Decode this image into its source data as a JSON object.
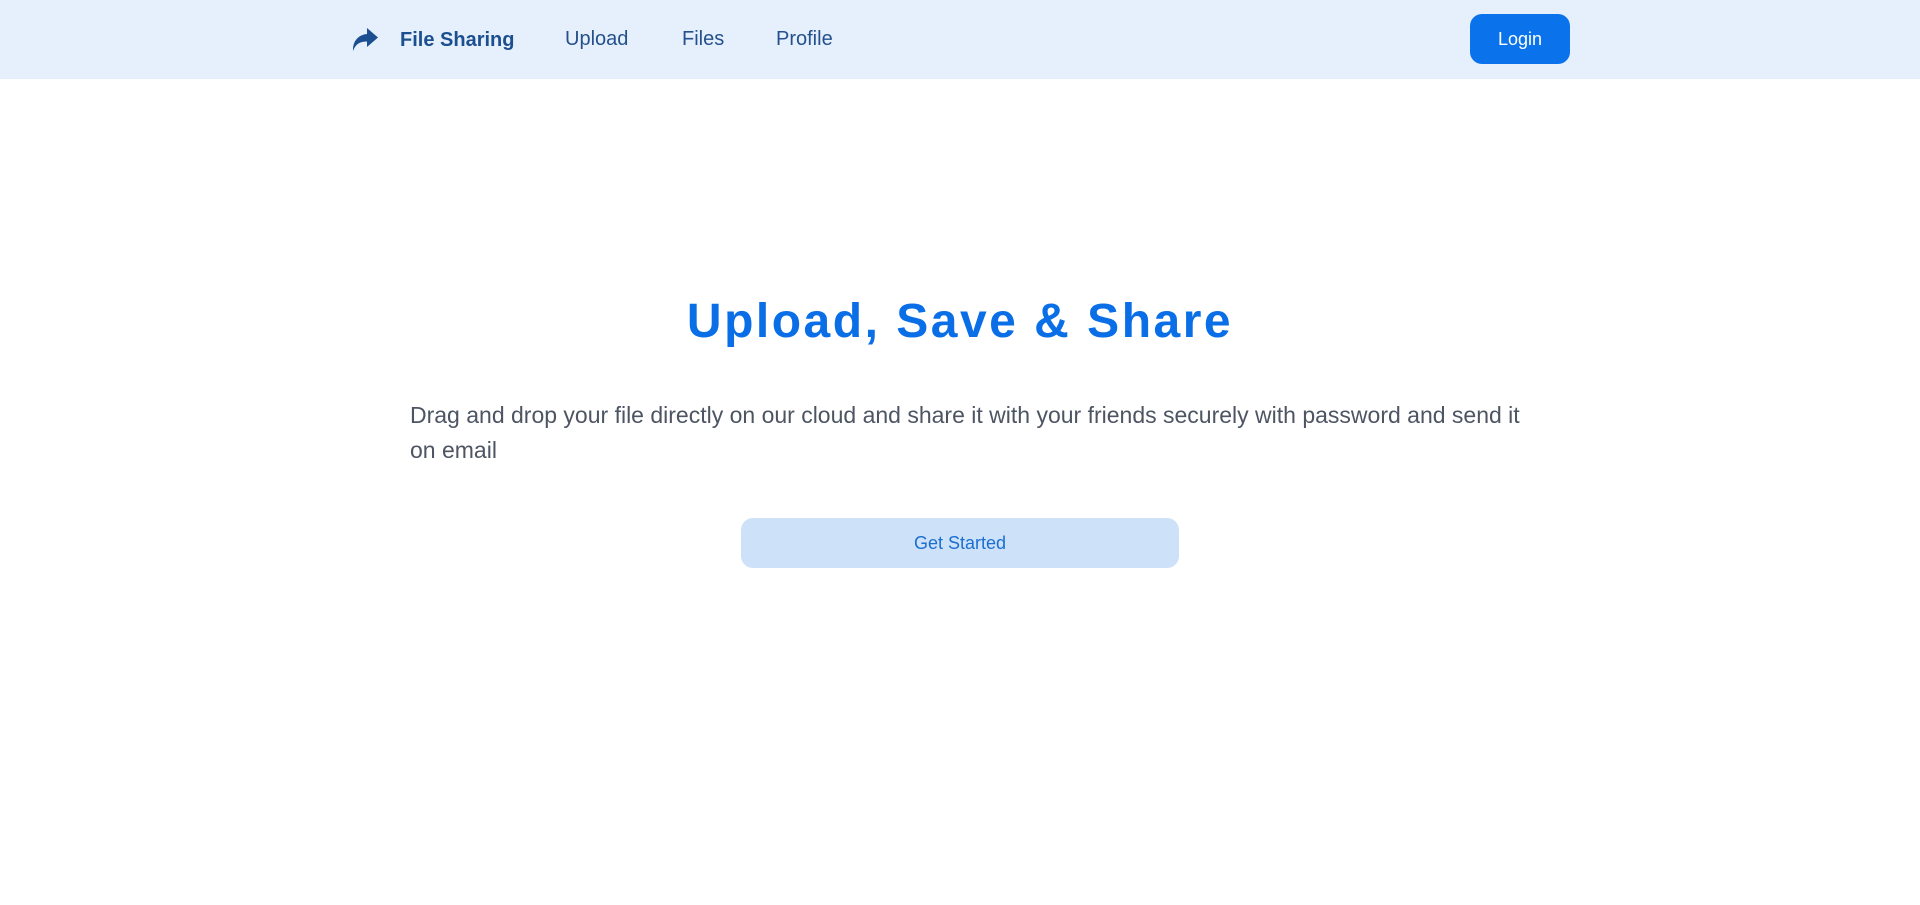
{
  "header": {
    "brand": {
      "icon": "share-arrow-icon",
      "title": "File Sharing"
    },
    "nav": {
      "upload": "Upload",
      "files": "Files",
      "profile": "Profile"
    },
    "login_label": "Login"
  },
  "hero": {
    "title": "Upload, Save & Share",
    "description": "Drag and drop your file directly on our cloud and share it with your friends securely with password and send it on email",
    "cta_label": "Get Started"
  },
  "colors": {
    "navbar_bg": "#e6f0fc",
    "brand_text": "#1c4f8f",
    "primary": "#0a73eb",
    "title": "#0a6fe6",
    "cta_bg": "#cde1f9",
    "cta_text": "#1a6fd1",
    "body_text": "#4d5563"
  }
}
